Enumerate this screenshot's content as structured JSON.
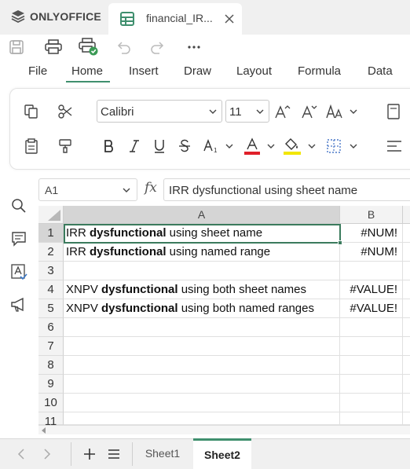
{
  "app": {
    "name": "ONLYOFFICE"
  },
  "document_tab": {
    "title": "financial_IR..."
  },
  "ribbon_tabs": [
    "File",
    "Home",
    "Insert",
    "Draw",
    "Layout",
    "Formula",
    "Data"
  ],
  "active_ribbon_tab": "Home",
  "font": {
    "name": "Calibri",
    "size": "11"
  },
  "formula_bar": {
    "name_box": "A1",
    "fx_label": "fx",
    "content": "IRR dysfunctional using sheet name"
  },
  "columns": [
    "A",
    "B"
  ],
  "rows": [
    {
      "num": "1",
      "a_pre": "IRR ",
      "a_bold": "dysfunctional",
      "a_post": " using sheet name",
      "b": "#NUM!"
    },
    {
      "num": "2",
      "a_pre": "IRR ",
      "a_bold": "dysfunctional",
      "a_post": " using named range",
      "b": "#NUM!"
    },
    {
      "num": "3",
      "a_pre": "",
      "a_bold": "",
      "a_post": "",
      "b": ""
    },
    {
      "num": "4",
      "a_pre": "XNPV ",
      "a_bold": "dysfunctional",
      "a_post": " using both sheet names",
      "b": "#VALUE!"
    },
    {
      "num": "5",
      "a_pre": "XNPV ",
      "a_bold": "dysfunctional",
      "a_post": " using both named ranges",
      "b": "#VALUE!"
    },
    {
      "num": "6",
      "a_pre": "",
      "a_bold": "",
      "a_post": "",
      "b": ""
    },
    {
      "num": "7",
      "a_pre": "",
      "a_bold": "",
      "a_post": "",
      "b": ""
    },
    {
      "num": "8",
      "a_pre": "",
      "a_bold": "",
      "a_post": "",
      "b": ""
    },
    {
      "num": "9",
      "a_pre": "",
      "a_bold": "",
      "a_post": "",
      "b": ""
    },
    {
      "num": "10",
      "a_pre": "",
      "a_bold": "",
      "a_post": "",
      "b": ""
    },
    {
      "num": "11",
      "a_pre": "",
      "a_bold": "",
      "a_post": "",
      "b": ""
    }
  ],
  "sheets": [
    {
      "name": "Sheet1",
      "active": false
    },
    {
      "name": "Sheet2",
      "active": true
    }
  ],
  "colors": {
    "accent": "#3f8f6e",
    "font_color_bar": "#e0202a",
    "fill_color_bar": "#f2e600"
  }
}
